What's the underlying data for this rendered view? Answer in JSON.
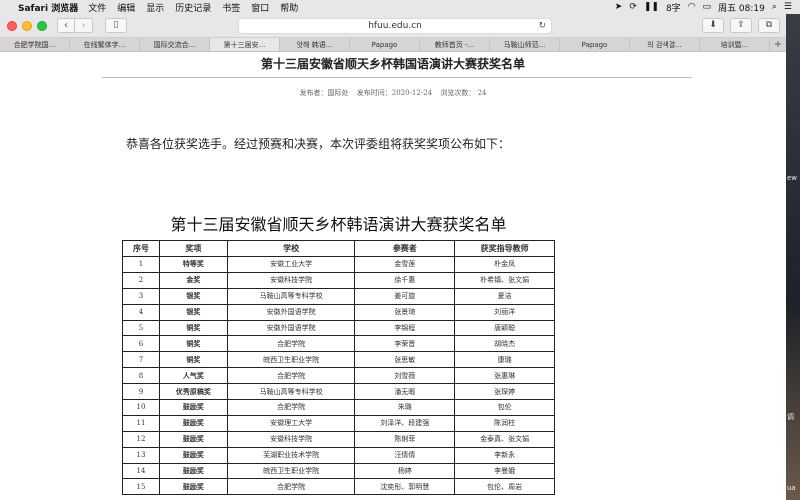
{
  "menubar": {
    "app": "Safari 浏览器",
    "items": [
      "文件",
      "编辑",
      "显示",
      "历史记录",
      "书签",
      "窗口",
      "帮助"
    ],
    "status_input": "8字",
    "clock": "周五 08:19"
  },
  "browser": {
    "url": "hfuu.edu.cn",
    "tabs": [
      "合肥学院国...",
      "在线繁体字...",
      "国际交流合...",
      "第十三届安...",
      "앗해 韩语...",
      "Papago",
      "教师首页 -...",
      "马鞍山师范...",
      "Papago",
      "의 검색결...",
      "培训暨..."
    ],
    "active_tab": 3
  },
  "article": {
    "title": "第十三届安徽省顺天乡杯韩国语演讲大赛获奖名单",
    "meta_publisher": "发布者：国际处",
    "meta_time": "发布时间：2020-12-24",
    "meta_views": "浏览次数：  24",
    "intro": "恭喜各位获奖选手。经过预赛和决赛，本次评委组将获奖奖项公布如下："
  },
  "table": {
    "title": "第十三届安徽省顺天乡杯韩语演讲大赛获奖名单",
    "headers": [
      "序号",
      "奖项",
      "学校",
      "参赛者",
      "获奖指导教师"
    ],
    "rows": [
      [
        "1",
        "特等奖",
        "安徽工业大学",
        "金雪莲",
        "朴金凤"
      ],
      [
        "2",
        "金奖",
        "安徽科技学院",
        "徐千惠",
        "朴希镇、张文娟"
      ],
      [
        "3",
        "银奖",
        "马鞍山高等专科学校",
        "姜可旋",
        "夏洁"
      ],
      [
        "4",
        "银奖",
        "安徽外国语学院",
        "张景琦",
        "刘丽洋"
      ],
      [
        "5",
        "铜奖",
        "安徽外国语学院",
        "李锦程",
        "唐颖聪"
      ],
      [
        "6",
        "铜奖",
        "合肥学院",
        "李荣晋",
        "胡晓杰"
      ],
      [
        "7",
        "铜奖",
        "皖西卫生职业学院",
        "张思敏",
        "康璐"
      ],
      [
        "8",
        "人气奖",
        "合肥学院",
        "刘雪薇",
        "张惠琳"
      ],
      [
        "9",
        "优秀原稿奖",
        "马鞍山高等专科学校",
        "潘无暇",
        "张琛婷"
      ],
      [
        "10",
        "鼓励奖",
        "合肥学院",
        "朱璐",
        "包伦"
      ],
      [
        "11",
        "鼓励奖",
        "安徽理工大学",
        "刘泽洋、段建强",
        "陈润柱"
      ],
      [
        "12",
        "鼓励奖",
        "安徽科技学院",
        "陈俐菲",
        "金泰真、张文娟"
      ],
      [
        "13",
        "鼓励奖",
        "芜湖职业技术学院",
        "汪倩倩",
        "李新永"
      ],
      [
        "14",
        "鼓励奖",
        "皖西卫生职业学院",
        "杨婷",
        "李曼娥"
      ],
      [
        "15",
        "鼓励奖",
        "合肥学院",
        "沈奕彤、郭明慧",
        "包伦、周岩"
      ]
    ]
  },
  "desktop": {
    "labels": [
      "ew",
      "调",
      "ua"
    ]
  }
}
